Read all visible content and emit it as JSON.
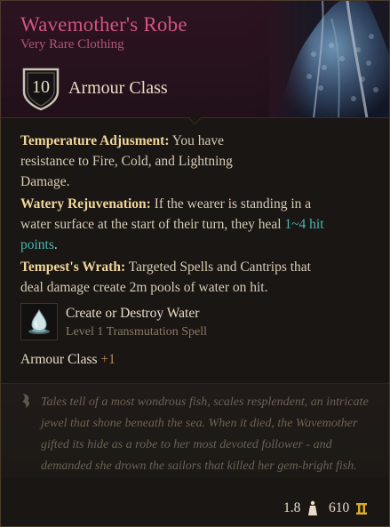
{
  "item": {
    "name": "Wavemother's Robe",
    "rarity": "Very Rare Clothing",
    "armour_class_value": "10",
    "armour_class_label": "Armour Class"
  },
  "properties": [
    {
      "name": "Temperature Adjusment:",
      "line1": " You have",
      "line2": "resistance to Fire, Cold, and Lightning",
      "line3": "Damage."
    },
    {
      "name": "Watery Rejuvenation:",
      "line1": " If the wearer is standing in a",
      "line2": "water surface at the start of their turn, they heal ",
      "highlight_a": "1~4 hit",
      "highlight_b": "points",
      "tail": "."
    },
    {
      "name": "Tempest's Wrath:",
      "line1": " Targeted Spells and Cantrips that",
      "line2": "deal damage create 2m pools of water on hit."
    }
  ],
  "spell": {
    "name": "Create or Destroy Water",
    "level": "Level 1 Transmutation Spell",
    "icon": "water-drop-icon"
  },
  "bonus": {
    "label": "Armour Class",
    "value": "+1"
  },
  "lore": {
    "lines": [
      "Tales tell of a most wondrous fish, scales resplendent, an intricate",
      "jewel that shone beneath the sea. When it died, the Wavemother",
      "gifted its hide as a robe to her most devoted follower - and",
      "demanded she drown the sailors that killed her gem-bright fish."
    ]
  },
  "footer": {
    "weight": "1.8",
    "weight_icon": "weight-icon",
    "value": "610",
    "gold_icon": "gold-coin-icon"
  },
  "colors": {
    "name": "#d4547e",
    "rarity": "#b05475",
    "property_name": "#f1d79a",
    "highlight": "#4ab7b0",
    "body": "#d9cbb4",
    "lore": "#6c6152"
  }
}
